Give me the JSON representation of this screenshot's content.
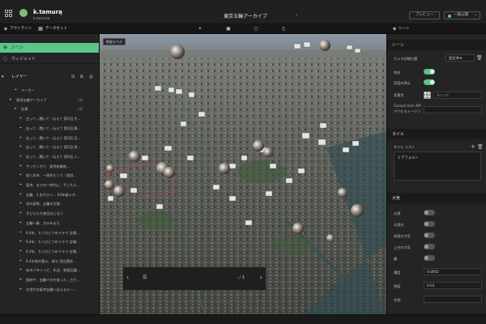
{
  "header": {
    "user_name": "k.tamura",
    "user_sub": "k.tamura",
    "project_title": "東京五輪アーカイブ",
    "preview_label": "プレビュー",
    "publish_label": "一般公開"
  },
  "tabs": {
    "outline": "アウトライン",
    "dataset": "データセット",
    "right": "シーン"
  },
  "left": {
    "scene_label": "シーン",
    "widget_label": "ウィジェット",
    "layers_label": "レイヤー",
    "tree": [
      {
        "label": "マーカー",
        "indent": 18,
        "pin": true
      },
      {
        "label": "東京五輪アーカイブ",
        "indent": 12,
        "count": "(3)",
        "folder": true
      },
      {
        "label": "記事",
        "indent": 18,
        "count": "(3)",
        "folder": true
      },
      {
        "label": "白って…聞いて・伝えて 第1回 大…",
        "indent": 24,
        "pin": true
      },
      {
        "label": "白って…聞いて・伝えて 第2回 競…",
        "indent": 24,
        "pin": true
      },
      {
        "label": "白って…聞いて・伝えて 第3回 日…",
        "indent": 24,
        "pin": true
      },
      {
        "label": "白って…聞いて・伝えて 第5回 郊…",
        "indent": 24,
        "pin": true
      },
      {
        "label": "白って…聞いて・伝えて 第6回 人…",
        "indent": 24,
        "pin": true
      },
      {
        "label": "ザッケンガで、東京商業地…",
        "indent": 24,
        "pin": true
      },
      {
        "label": "陸八木市、一周年たくて／陸陸…",
        "indent": 24,
        "pin": true
      },
      {
        "label": "東京、おでの一時代に、手ごたえ…",
        "indent": 24,
        "pin": true
      },
      {
        "label": "五輪、2 金代ラン… 64年銀メダ…",
        "indent": 24,
        "pin": true
      },
      {
        "label": "母の面熊、五輪の大聖…",
        "indent": 24,
        "pin": true
      },
      {
        "label": "子どもたち商売応じなう",
        "indent": 24,
        "pin": true
      },
      {
        "label": "五輪へ事、大のみまた",
        "indent": 24,
        "pin": true
      },
      {
        "label": "6.4年、もうひとつのドラマ 会場…",
        "indent": 24,
        "pin": true
      },
      {
        "label": "6.4年、もうひとつのドラマ 会場…",
        "indent": 24,
        "pin": true
      },
      {
        "label": "6.4年、もうひとつのドラマ 会場…",
        "indent": 24,
        "pin": true
      },
      {
        "label": "6.4年前の聖火、探せ 国立競技…",
        "indent": 24,
        "pin": true
      },
      {
        "label": "あのパラリンピ、年会、新宿区議…",
        "indent": 24,
        "pin": true
      },
      {
        "label": "国府や、五輪で光を放った…三千…",
        "indent": 24,
        "pin": true
      },
      {
        "label": "次世代の東京五輪へ応えるルー…",
        "indent": 24,
        "pin": true
      }
    ]
  },
  "map": {
    "badge": "地面ラベル",
    "story_page": "- / 3"
  },
  "right": {
    "scene_section": "シーン",
    "camera_label": "カメラ初期位置",
    "camera_value": "設定済み",
    "terrain_label": "地形",
    "terrain_on": true,
    "depth_label": "深度の表示",
    "depth_on": true,
    "bg_label": "背景色",
    "bg_placeholder": "Not set",
    "cesium_label_1": "Cesium Icon API",
    "cesium_label_2": "アクセストークン",
    "tile_section": "タイル",
    "tile_list_label": "タイル リスト",
    "tile_item": "1 デフォルト",
    "atm_section": "大気",
    "sun_label": "太陽",
    "sun_shadow_label": "太陽光",
    "ground_atm_label": "地表の大気",
    "sky_atm_label": "上空の大気",
    "fog_label": "霧",
    "density_label": "濃度",
    "density_value": "0.0002",
    "brightness_label": "明度",
    "brightness_value": "0.03",
    "hue_label": "色相",
    "sun_on": false,
    "sun_shadow_on": false,
    "ground_atm_on": false,
    "sky_atm_on": false,
    "fog_on": false
  },
  "colors": {
    "accent": "#5cc48a",
    "panel": "#242424"
  }
}
